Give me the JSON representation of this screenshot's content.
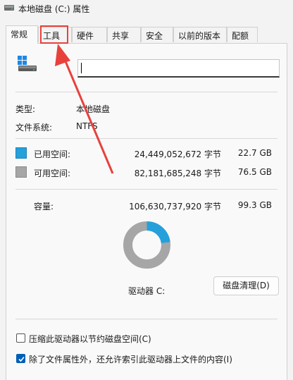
{
  "window": {
    "title": "本地磁盘 (C:) 属性"
  },
  "tabs": [
    {
      "label": "常规"
    },
    {
      "label": "工具"
    },
    {
      "label": "硬件"
    },
    {
      "label": "共享"
    },
    {
      "label": "安全"
    },
    {
      "label": "以前的版本"
    },
    {
      "label": "配额"
    }
  ],
  "general": {
    "volume_name_value": "",
    "type_label": "类型:",
    "type_value": "本地磁盘",
    "fs_label": "文件系统:",
    "fs_value": "NTFS",
    "used_label": "已用空间:",
    "used_bytes": "24,449,052,672 字节",
    "used_size": "22.7 GB",
    "free_label": "可用空间:",
    "free_bytes": "82,181,685,248 字节",
    "free_size": "76.5 GB",
    "capacity_label": "容量:",
    "capacity_bytes": "106,630,737,920 字节",
    "capacity_size": "99.3 GB",
    "drive_label": "驱动器 C:",
    "cleanup_button": "磁盘清理(D)",
    "compress_label": "压缩此驱动器以节约磁盘空间(C)",
    "compress_checked": false,
    "index_label": "除了文件属性外，还允许索引此驱动器上文件的内容(I)",
    "index_checked": true,
    "used_fraction": 0.229
  },
  "colors": {
    "used": "#26a0da",
    "free": "#a6a6a6",
    "annotation": "#e8413c",
    "checkbox": "#005fb8"
  }
}
